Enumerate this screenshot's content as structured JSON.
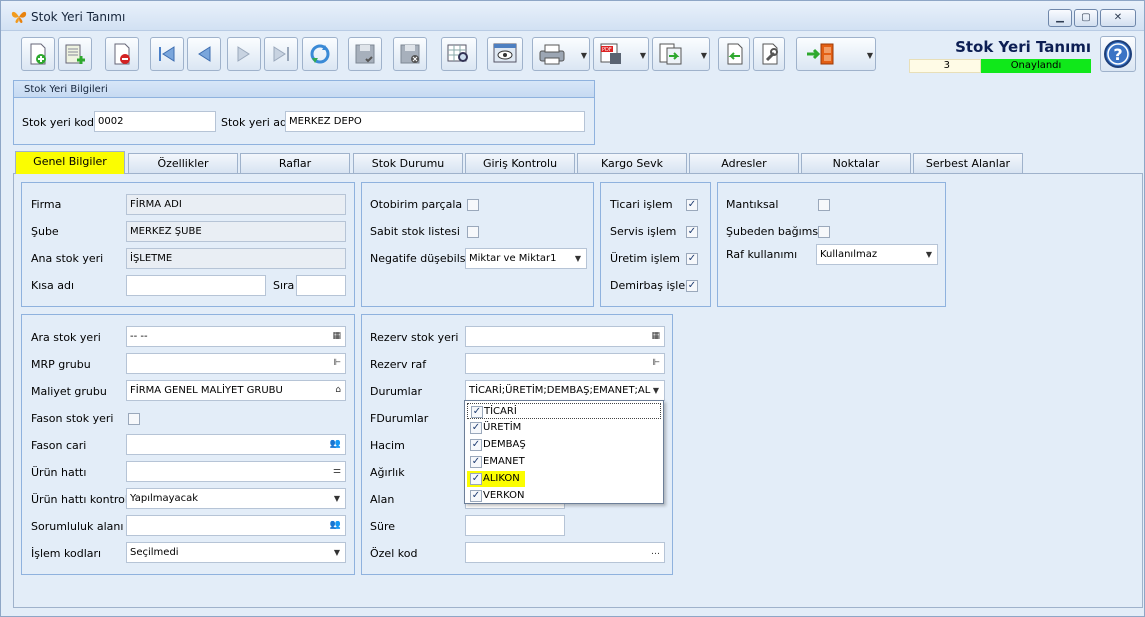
{
  "window": {
    "title": "Stok Yeri Tanımı"
  },
  "header": {
    "title": "Stok Yeri Tanımı",
    "record_number": "3",
    "status": "Onaylandı"
  },
  "group": {
    "caption": "Stok Yeri Bilgileri",
    "code_label": "Stok yeri kodu",
    "code_value": "0002",
    "name_label": "Stok yeri adı",
    "name_value": "MERKEZ DEPO"
  },
  "tabs": [
    "Genel Bilgiler",
    "Özellikler",
    "Raflar",
    "Stok Durumu",
    "Giriş Kontrolu",
    "Kargo Sevk",
    "Adresler",
    "Noktalar",
    "Serbest Alanlar"
  ],
  "general": {
    "firma_label": "Firma",
    "firma_value": "FİRMA ADI",
    "sube_label": "Şube",
    "sube_value": "MERKEZ ŞUBE",
    "ana_label": "Ana stok yeri",
    "ana_value": "İŞLETME",
    "kisa_label": "Kısa adı",
    "sira_label": "Sıra"
  },
  "options1": {
    "otobirim_label": "Otobirim parçala",
    "sabit_label": "Sabit stok listesi",
    "negatif_label": "Negatife düşebilsin",
    "negatif_value": "Miktar ve Miktar1"
  },
  "options2": {
    "ticari_label": "Ticari işlem",
    "servis_label": "Servis işlem",
    "uretim_label": "Üretim işlem",
    "demirbas_label": "Demirbaş işlem"
  },
  "options3": {
    "mantiksal_label": "Mantıksal",
    "subeden_label": "Şubeden bağımsız",
    "raf_label": "Raf kullanımı",
    "raf_value": "Kullanılmaz"
  },
  "details": {
    "ara_label": "Ara stok yeri",
    "ara_value": "-- --",
    "mrp_label": "MRP grubu",
    "maliyet_label": "Maliyet grubu",
    "maliyet_value": "FİRMA GENEL MALİYET GRUBU",
    "fason_label": "Fason stok yeri",
    "fason_cari_label": "Fason cari",
    "urun_hatti_label": "Ürün hattı",
    "urun_kontrol_label": "Ürün hattı kontrolü",
    "urun_kontrol_value": "Yapılmayacak",
    "sorumluluk_label": "Sorumluluk alanı",
    "islem_label": "İşlem kodları",
    "islem_value": "Seçilmedi"
  },
  "reserve": {
    "rezerv_stok_label": "Rezerv stok yeri",
    "rezerv_raf_label": "Rezerv raf",
    "durumlar_label": "Durumlar",
    "durumlar_value": "TİCARİ;ÜRETİM;DEMBAŞ;EMANET;AL",
    "fdurumlar_label": "FDurumlar",
    "hacim_label": "Hacim",
    "agirlik_label": "Ağırlık",
    "alan_label": "Alan",
    "sure_label": "Süre",
    "ozel_label": "Özel kod"
  },
  "dropdown": {
    "items": [
      {
        "label": "TİCARİ",
        "checked": true
      },
      {
        "label": "ÜRETİM",
        "checked": true
      },
      {
        "label": "DEMBAŞ",
        "checked": true
      },
      {
        "label": "EMANET",
        "checked": true
      },
      {
        "label": "ALIKON",
        "checked": true
      },
      {
        "label": "VERKON",
        "checked": true
      }
    ]
  },
  "colors": {
    "approved": "#10e81a",
    "highlight": "#fbfd01",
    "title_text": "#0c1e53"
  }
}
